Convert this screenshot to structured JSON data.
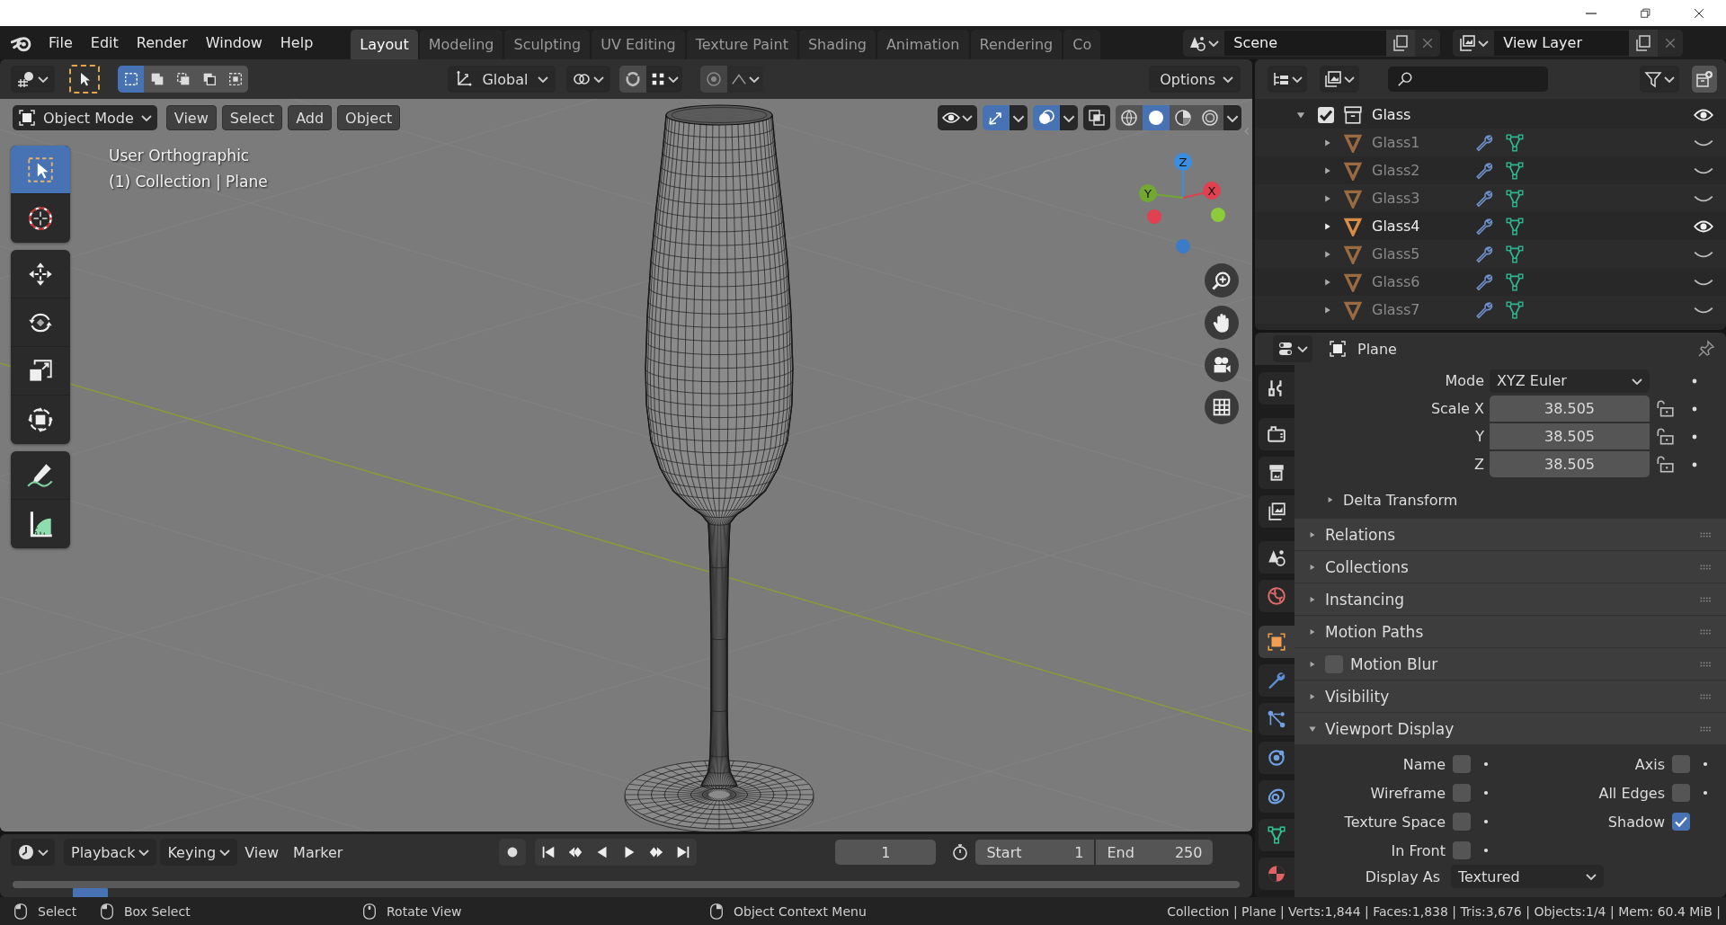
{
  "menu": [
    "File",
    "Edit",
    "Render",
    "Window",
    "Help"
  ],
  "workspaces": [
    {
      "label": "Layout",
      "selected": true
    },
    {
      "label": "Modeling",
      "selected": false
    },
    {
      "label": "Sculpting",
      "selected": false
    },
    {
      "label": "UV Editing",
      "selected": false
    },
    {
      "label": "Texture Paint",
      "selected": false
    },
    {
      "label": "Shading",
      "selected": false
    },
    {
      "label": "Animation",
      "selected": false
    },
    {
      "label": "Rendering",
      "selected": false
    },
    {
      "label": "Co",
      "selected": false
    }
  ],
  "scene": "Scene",
  "view_layer": "View Layer",
  "tool_settings": {
    "select_modes": [
      {
        "selected": true
      },
      {
        "selected": false
      },
      {
        "selected": false
      },
      {
        "selected": false
      },
      {
        "selected": false
      }
    ],
    "orientation": "Global",
    "options": "Options"
  },
  "viewport": {
    "mode": "Object Mode",
    "menus": [
      "View",
      "Select",
      "Add",
      "Object"
    ],
    "view_name": "User Orthographic",
    "context": "(1) Collection | Plane",
    "tools": [
      {
        "kind": "select_box",
        "selected": true
      },
      {
        "kind": "cursor",
        "selected": false
      },
      {
        "kind": "move",
        "selected": false
      },
      {
        "kind": "rotate",
        "selected": false
      },
      {
        "kind": "scale",
        "selected": false
      },
      {
        "kind": "transform",
        "selected": false
      },
      {
        "kind": "annotate",
        "selected": false
      },
      {
        "kind": "measure",
        "selected": false
      }
    ],
    "axes": {
      "x": "X",
      "y": "Y",
      "z": "Z"
    },
    "show_gizmo": true,
    "show_overlays": true,
    "xray": false,
    "shading": [
      {
        "kind": "wireframe",
        "selected": false
      },
      {
        "kind": "solid",
        "selected": true
      },
      {
        "kind": "material",
        "selected": false
      },
      {
        "kind": "rendered",
        "selected": false
      }
    ]
  },
  "outliner": {
    "tree": [
      {
        "name": "Glass",
        "checked": true,
        "expanded": true,
        "visible": true,
        "children": [
          {
            "name": "Glass1",
            "expanded": false,
            "visible": false
          },
          {
            "name": "Glass2",
            "expanded": false,
            "visible": false
          },
          {
            "name": "Glass3",
            "expanded": false,
            "visible": false
          },
          {
            "name": "Glass4",
            "expanded": false,
            "visible": true
          },
          {
            "name": "Glass5",
            "expanded": false,
            "visible": false
          },
          {
            "name": "Glass6",
            "expanded": false,
            "visible": false
          },
          {
            "name": "Glass7",
            "expanded": false,
            "visible": false
          }
        ]
      }
    ]
  },
  "properties": {
    "object": "Plane",
    "tabs": [
      {
        "kind": "tool",
        "selected": false
      },
      {
        "kind": "render",
        "selected": false
      },
      {
        "kind": "output",
        "selected": false
      },
      {
        "kind": "view_layer",
        "selected": false
      },
      {
        "kind": "scene",
        "selected": false
      },
      {
        "kind": "world",
        "selected": false
      },
      {
        "kind": "object",
        "selected": true
      },
      {
        "kind": "modifiers",
        "selected": false
      },
      {
        "kind": "particles",
        "selected": false
      },
      {
        "kind": "physics",
        "selected": false
      },
      {
        "kind": "constraints",
        "selected": false
      },
      {
        "kind": "data",
        "selected": false
      },
      {
        "kind": "material",
        "selected": false
      }
    ],
    "rotation_mode": {
      "label": "Mode",
      "value": "XYZ Euler"
    },
    "scale": [
      {
        "label": "Scale X",
        "value": "38.505"
      },
      {
        "label": "Y",
        "value": "38.505"
      },
      {
        "label": "Z",
        "value": "38.505"
      }
    ],
    "delta_transform": {
      "title": "Delta Transform",
      "expanded": false
    },
    "panels": [
      {
        "kind": "plain",
        "title": "Relations",
        "expanded": false
      },
      {
        "kind": "plain",
        "title": "Collections",
        "expanded": false
      },
      {
        "kind": "plain",
        "title": "Instancing",
        "expanded": false
      },
      {
        "kind": "plain",
        "title": "Motion Paths",
        "expanded": false
      },
      {
        "kind": "toggle",
        "title": "Motion Blur",
        "expanded": false,
        "checked": false
      },
      {
        "kind": "plain",
        "title": "Visibility",
        "expanded": false
      },
      {
        "kind": "plain",
        "title": "Viewport Display",
        "expanded": true
      }
    ],
    "viewport_display": {
      "options": [
        {
          "label": "Name",
          "checked": false,
          "keyframe": true
        },
        {
          "label": "Axis",
          "checked": false,
          "keyframe": true
        },
        {
          "label": "Wireframe",
          "checked": false,
          "keyframe": true
        },
        {
          "label": "All Edges",
          "checked": false,
          "keyframe": true
        },
        {
          "label": "Texture Space",
          "checked": false,
          "keyframe": true
        },
        {
          "label": "Shadow",
          "checked": true,
          "keyframe": false
        },
        {
          "label": "In Front",
          "checked": false,
          "keyframe": true
        }
      ],
      "display_as": {
        "label": "Display As",
        "value": "Textured"
      }
    }
  },
  "timeline": {
    "menus": [
      {
        "label": "Playback",
        "kind": "dropdown"
      },
      {
        "label": "Keying",
        "kind": "dropdown"
      },
      {
        "label": "View",
        "kind": "menu"
      },
      {
        "label": "Marker",
        "kind": "menu"
      }
    ],
    "current_frame": "1",
    "start": {
      "label": "Start",
      "value": "1"
    },
    "end": {
      "label": "End",
      "value": "250"
    }
  },
  "status_bar": {
    "hints": [
      {
        "kind": "left_click",
        "label": "Select"
      },
      {
        "kind": "left_drag",
        "label": "Box Select"
      },
      {
        "kind": "middle_click",
        "label": "Rotate View"
      },
      {
        "kind": "right_click",
        "label": "Object Context Menu"
      }
    ],
    "stats": "Collection | Plane | Verts:1,844 | Faces:1,838 | Tris:3,676 | Objects:1/4 | Mem: 60.4 MiB |"
  }
}
